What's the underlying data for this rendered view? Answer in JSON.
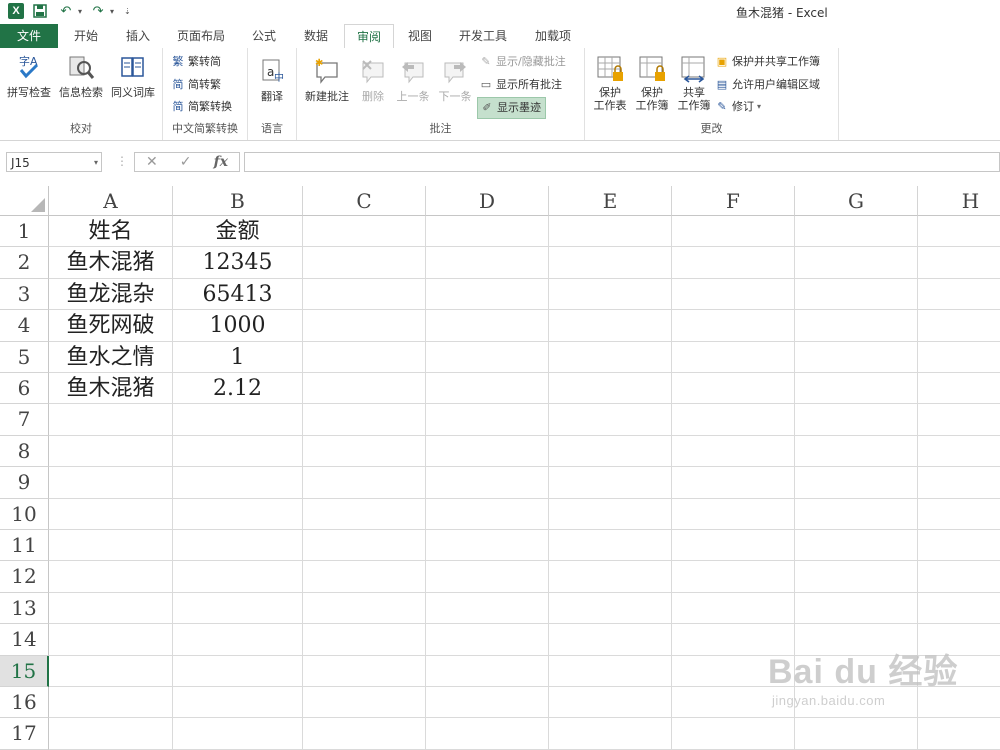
{
  "window": {
    "title": "鱼木混猪 - Excel"
  },
  "ribbon_tabs": [
    {
      "id": "file",
      "label": "文件"
    },
    {
      "id": "home",
      "label": "开始"
    },
    {
      "id": "insert",
      "label": "插入"
    },
    {
      "id": "layout",
      "label": "页面布局"
    },
    {
      "id": "formulas",
      "label": "公式"
    },
    {
      "id": "data",
      "label": "数据"
    },
    {
      "id": "review",
      "label": "审阅",
      "active": true
    },
    {
      "id": "view",
      "label": "视图"
    },
    {
      "id": "developer",
      "label": "开发工具"
    },
    {
      "id": "addins",
      "label": "加载项"
    }
  ],
  "ribbon": {
    "proofing": {
      "label": "校对",
      "spelling": "拼写检查",
      "research": "信息检索",
      "thesaurus": "同义词库"
    },
    "chinese": {
      "label": "中文简繁转换",
      "to_simplified": "繁转简",
      "to_traditional": "简转繁",
      "convert": "简繁转换"
    },
    "language": {
      "label": "语言",
      "translate": "翻译"
    },
    "comments": {
      "label": "批注",
      "new_comment": "新建批注",
      "delete": "删除",
      "previous": "上一条",
      "next": "下一条",
      "show_hide": "显示/隐藏批注",
      "show_all": "显示所有批注",
      "show_ink": "显示墨迹"
    },
    "changes": {
      "label": "更改",
      "protect_sheet": "保护\n工作表",
      "protect_workbook": "保护\n工作簿",
      "share_workbook": "共享\n工作簿",
      "protect_share": "保护并共享工作簿",
      "allow_edit": "允许用户编辑区域",
      "track_changes": "修订"
    }
  },
  "formula_bar": {
    "name_box": "J15",
    "fx": "fx",
    "formula": ""
  },
  "columns": [
    "A",
    "B",
    "C",
    "D",
    "E",
    "F",
    "G",
    "H"
  ],
  "rows": [
    "1",
    "2",
    "3",
    "4",
    "5",
    "6",
    "7",
    "8",
    "9",
    "10",
    "11",
    "12",
    "13",
    "14",
    "15",
    "16",
    "17"
  ],
  "selected_row": "15",
  "cells": [
    {
      "r": 1,
      "c": "A",
      "v": "姓名"
    },
    {
      "r": 1,
      "c": "B",
      "v": "金额"
    },
    {
      "r": 2,
      "c": "A",
      "v": "鱼木混猪"
    },
    {
      "r": 2,
      "c": "B",
      "v": "12345"
    },
    {
      "r": 3,
      "c": "A",
      "v": "鱼龙混杂"
    },
    {
      "r": 3,
      "c": "B",
      "v": "65413"
    },
    {
      "r": 4,
      "c": "A",
      "v": "鱼死网破"
    },
    {
      "r": 4,
      "c": "B",
      "v": "1000"
    },
    {
      "r": 5,
      "c": "A",
      "v": "鱼水之情"
    },
    {
      "r": 5,
      "c": "B",
      "v": "1"
    },
    {
      "r": 6,
      "c": "A",
      "v": "鱼木混猪"
    },
    {
      "r": 6,
      "c": "B",
      "v": "2.12"
    }
  ],
  "watermark": {
    "logo": "Bai du 经验",
    "url": "jingyan.baidu.com"
  },
  "colors": {
    "accent": "#217346",
    "highlight": "#c5e0cd"
  }
}
